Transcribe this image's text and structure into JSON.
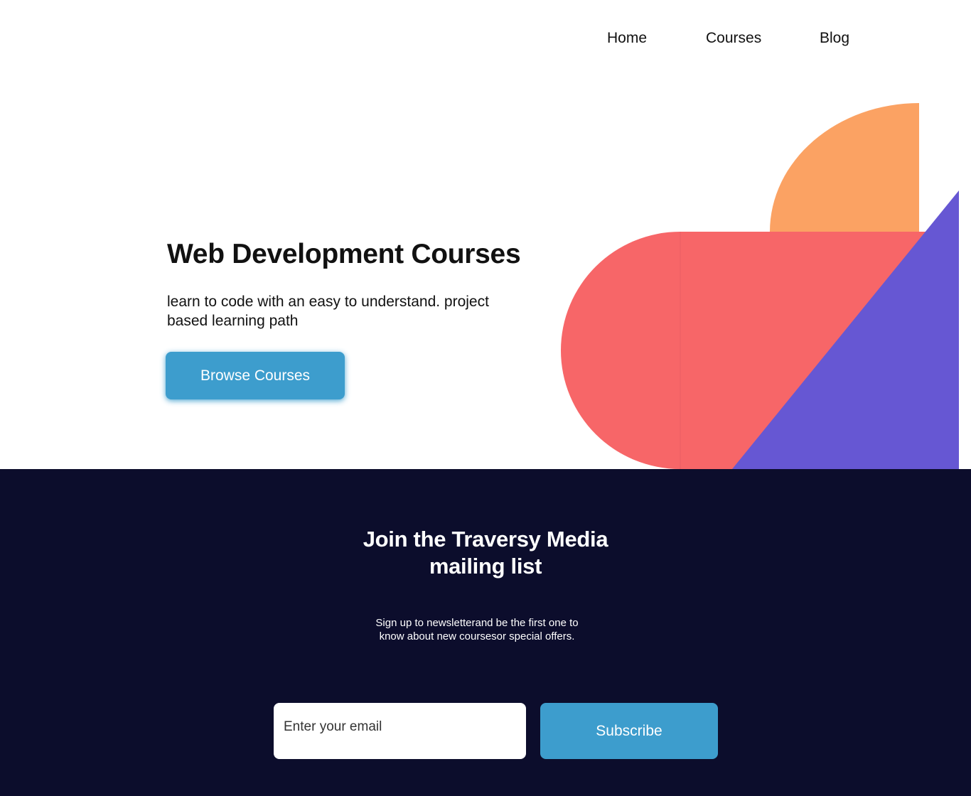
{
  "nav": {
    "items": [
      {
        "label": "Home"
      },
      {
        "label": "Courses"
      },
      {
        "label": "Blog"
      }
    ]
  },
  "hero": {
    "title": "Web Development Courses",
    "text": "learn to code with an easy to understand. project based learning path",
    "button_label": "Browse Courses"
  },
  "newsletter": {
    "title_line1": "Join the Traversy Media",
    "title_line2": "mailing list",
    "text_line1": "Sign up to newsletterand be the first one to",
    "text_line2": "know about new coursesor special offers.",
    "email_placeholder": "Enter your email",
    "subscribe_label": "Subscribe"
  },
  "colors": {
    "accent": "#3d9dcd",
    "dark_bg": "#0c0d2c",
    "orange": "#fba263",
    "coral": "#f76668",
    "purple": "#6657d3"
  }
}
